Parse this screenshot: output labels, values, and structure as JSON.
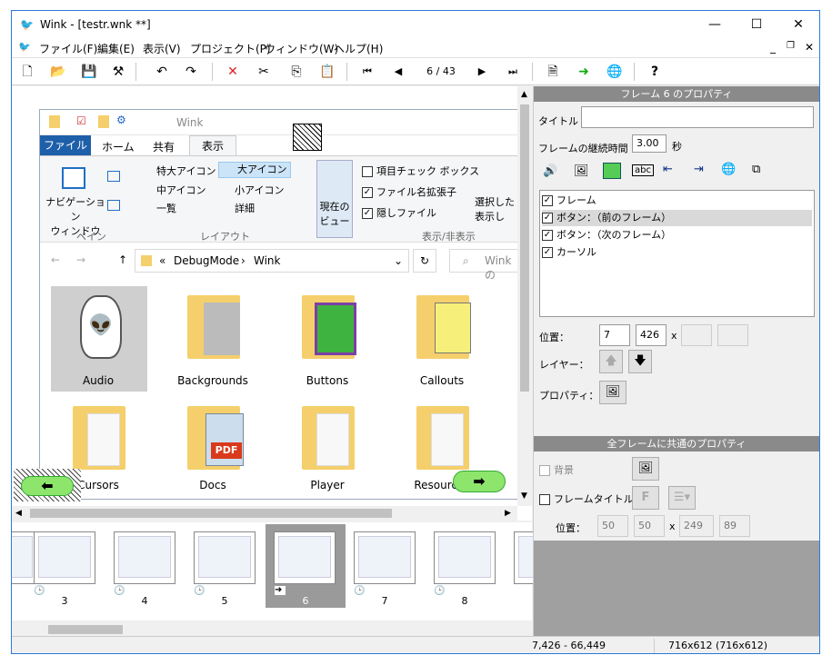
{
  "window": {
    "title": "Wink - [testr.wnk **]",
    "minimize": "—",
    "maximize": "☐",
    "close": "✕"
  },
  "menu": [
    "ファイル(F)",
    "編集(E)",
    "表示(V)",
    "プロジェクト(P)",
    "ウィンドウ(W)",
    "ヘルプ(H)"
  ],
  "toolbar": {
    "page": "6 / 43"
  },
  "explorer": {
    "title": "Wink",
    "tabs": [
      "ファイル",
      "ホーム",
      "共有",
      "表示"
    ],
    "ribbon": {
      "nav_pane": "ナビゲーション\nウィンドウ",
      "pane_group": "ペイン",
      "xl_icons": "特大アイコン",
      "l_icons": "大アイコン",
      "m_icons": "中アイコン",
      "s_icons": "小アイコン",
      "list": "一覧",
      "details": "詳細",
      "layout_group": "レイアウト",
      "current_view": "現在の\nビュー",
      "chk_items": "項目チェック ボックス",
      "chk_ext": "ファイル名拡張子",
      "chk_hidden": "隠しファイル",
      "hide_sel": "選択した\n表示し",
      "show_group": "表示/非表示"
    },
    "path": [
      "DebugMode",
      "Wink"
    ],
    "search": "Winkの",
    "folders": [
      "Audio",
      "Backgrounds",
      "Buttons",
      "Callouts",
      "Cursors",
      "Docs",
      "Player",
      "Resources"
    ]
  },
  "frame_props": {
    "header": "フレーム 6 のプロパティ",
    "title_label": "タイトル",
    "title_value": "",
    "duration_label": "フレームの継続時間",
    "duration_value": "3.00",
    "duration_unit": "秒",
    "layers": [
      {
        "label": "フレーム",
        "checked": true
      },
      {
        "label": "ボタン：（前のフレーム）",
        "checked": true
      },
      {
        "label": "ボタン：（次のフレーム）",
        "checked": true
      },
      {
        "label": "カーソル",
        "checked": true
      }
    ],
    "pos_label": "位置：",
    "pos_x": "7",
    "pos_y": "426",
    "pos_sep": "x",
    "pos_w": "",
    "pos_h": "",
    "layer_label": "レイヤー：",
    "prop_label": "プロパティ："
  },
  "common_props": {
    "header": "全フレームに共通のプロパティ",
    "bg_label": "背景",
    "frame_title_label": "フレームタイトル",
    "font_btn": "F",
    "pos_label": "位置：",
    "pos_x": "50",
    "pos_y": "50",
    "pos_sep": "x",
    "pos_w": "249",
    "pos_h": "89"
  },
  "thumbnails": [
    "3",
    "4",
    "5",
    "6",
    "7",
    "8"
  ],
  "status": {
    "coords": "7,426 - 66,449",
    "size": "716x612 (716x612)"
  }
}
